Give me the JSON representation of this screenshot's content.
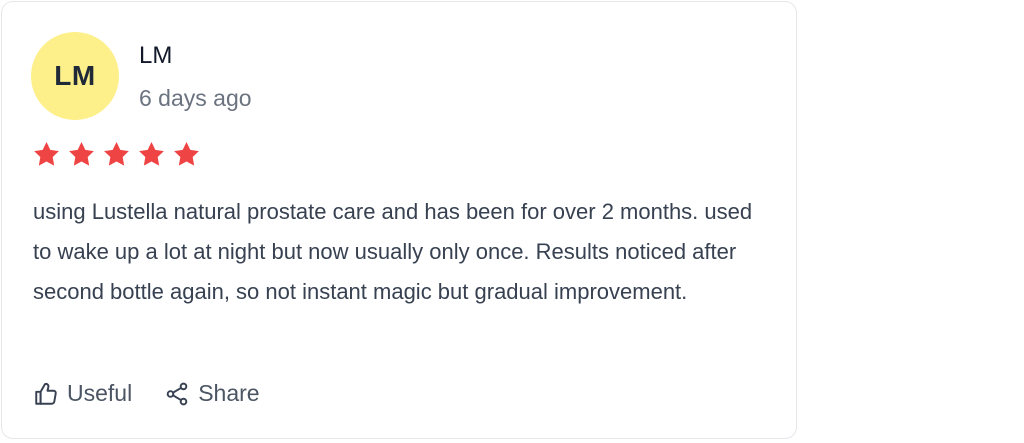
{
  "review": {
    "avatar_initials": "LM",
    "author": "LM",
    "date": "6 days ago",
    "rating": 5,
    "rating_max": 5,
    "text": "using Lustella natural prostate care and has been for over 2 months. used to wake up a lot at night but now usually only once. Results noticed after second bottle again, so not instant magic but gradual improvement."
  },
  "actions": {
    "useful_label": "Useful",
    "share_label": "Share"
  },
  "colors": {
    "avatar_bg": "#fdf08a",
    "star": "#ef4444",
    "border": "#e5e7eb"
  },
  "icons": {
    "star": "star-icon",
    "useful": "thumbs-up-icon",
    "share": "share-icon"
  }
}
